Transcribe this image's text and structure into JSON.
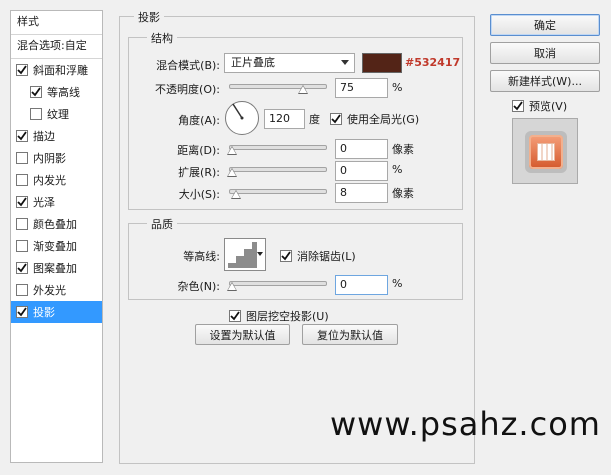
{
  "left_panel": {
    "header": "样式",
    "blend_options": "混合选项:自定",
    "items": [
      {
        "label": "斜面和浮雕",
        "checked": true,
        "sub": false,
        "selected": false
      },
      {
        "label": "等高线",
        "checked": true,
        "sub": true,
        "selected": false
      },
      {
        "label": "纹理",
        "checked": false,
        "sub": true,
        "selected": false
      },
      {
        "label": "描边",
        "checked": true,
        "sub": false,
        "selected": false
      },
      {
        "label": "内阴影",
        "checked": false,
        "sub": false,
        "selected": false
      },
      {
        "label": "内发光",
        "checked": false,
        "sub": false,
        "selected": false
      },
      {
        "label": "光泽",
        "checked": true,
        "sub": false,
        "selected": false
      },
      {
        "label": "颜色叠加",
        "checked": false,
        "sub": false,
        "selected": false
      },
      {
        "label": "渐变叠加",
        "checked": false,
        "sub": false,
        "selected": false
      },
      {
        "label": "图案叠加",
        "checked": true,
        "sub": false,
        "selected": false
      },
      {
        "label": "外发光",
        "checked": false,
        "sub": false,
        "selected": false
      },
      {
        "label": "投影",
        "checked": true,
        "sub": false,
        "selected": true
      }
    ]
  },
  "section_title": "投影",
  "structure": {
    "title": "结构",
    "blend_mode_label": "混合模式(B):",
    "blend_mode_value": "正片叠底",
    "swatch_color": "#532417",
    "swatch_label": "#532417",
    "opacity_label": "不透明度(O):",
    "opacity_value": "75",
    "opacity_fraction": 0.75,
    "percent": "%",
    "angle_label": "角度(A):",
    "angle_value": "120",
    "angle_unit": "度",
    "global_light_label": "使用全局光(G)",
    "global_light_checked": true,
    "distance_label": "距离(D):",
    "distance_value": "0",
    "distance_unit": "像素",
    "spread_label": "扩展(R):",
    "spread_value": "0",
    "size_label": "大小(S):",
    "size_value": "8",
    "size_unit": "像素"
  },
  "quality": {
    "title": "品质",
    "contour_label": "等高线:",
    "anti_alias_label": "消除锯齿(L)",
    "anti_alias_checked": true,
    "noise_label": "杂色(N):",
    "noise_value": "0",
    "percent": "%"
  },
  "knockout_label": "图层挖空投影(U)",
  "knockout_checked": true,
  "set_default_label": "设置为默认值",
  "reset_default_label": "复位为默认值",
  "buttons": {
    "ok": "确定",
    "cancel": "取消",
    "new_style": "新建样式(W)...",
    "preview_label": "预览(V)",
    "preview_checked": true
  },
  "watermark": "www.psahz.com"
}
